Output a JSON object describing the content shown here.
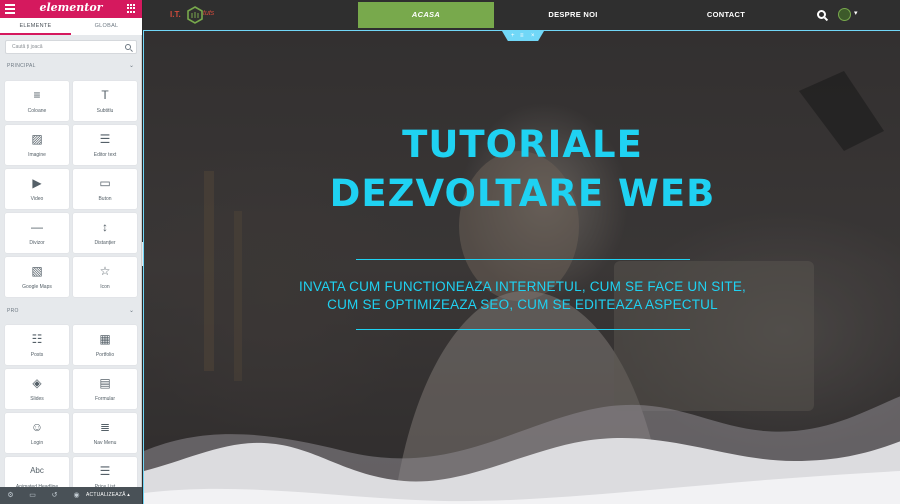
{
  "panel": {
    "logo": "elementor",
    "tabs": [
      "ELEMENTE",
      "GLOBAL"
    ],
    "search_placeholder": "Caută ți joacă",
    "sections": {
      "principal": "PRINCIPAL",
      "pro": "PRO"
    },
    "principal_widgets": [
      {
        "label": "Coloane",
        "icon": "columns-icon"
      },
      {
        "label": "Subtitlu",
        "icon": "heading-icon"
      },
      {
        "label": "Imagine",
        "icon": "image-icon"
      },
      {
        "label": "Editor text",
        "icon": "text-editor-icon"
      },
      {
        "label": "Video",
        "icon": "video-icon"
      },
      {
        "label": "Buton",
        "icon": "button-icon"
      },
      {
        "label": "Divizor",
        "icon": "divider-icon"
      },
      {
        "label": "Distanțier",
        "icon": "spacer-icon"
      },
      {
        "label": "Google Maps",
        "icon": "map-icon"
      },
      {
        "label": "Icon",
        "icon": "star-icon"
      }
    ],
    "pro_widgets": [
      {
        "label": "Posts",
        "icon": "posts-icon"
      },
      {
        "label": "Portfolio",
        "icon": "portfolio-icon"
      },
      {
        "label": "Slides",
        "icon": "slides-icon"
      },
      {
        "label": "Formular",
        "icon": "form-icon"
      },
      {
        "label": "Login",
        "icon": "login-icon"
      },
      {
        "label": "Nav Menu",
        "icon": "nav-menu-icon"
      },
      {
        "label": "Animated Headline",
        "icon": "animated-headline-icon"
      },
      {
        "label": "Price List",
        "icon": "price-list-icon"
      }
    ],
    "footer": {
      "update_label": "ACTUALIZEAZĂ"
    }
  },
  "site": {
    "logo": {
      "left": "I.T.",
      "right": "tuts"
    },
    "menu": [
      {
        "label": "ACASA",
        "active": true
      },
      {
        "label": "DESPRE NOI",
        "active": false
      },
      {
        "label": "CONTACT",
        "active": false
      }
    ],
    "hero": {
      "title_line1": "TUTORIALE",
      "title_line2": "DEZVOLTARE WEB",
      "subtitle_line1": "INVATA CUM FUNCTIONEAZA INTERNETUL, CUM SE FACE UN SITE,",
      "subtitle_line2": "CUM SE OPTIMIZEAZA SEO, CUM SE EDITEAZA ASPECTUL"
    }
  },
  "colors": {
    "elementor_brand": "#d5195e",
    "accent_cyan": "#1fd2f2",
    "menu_active": "#78a94c",
    "nav_bg": "#2f2f2f"
  }
}
